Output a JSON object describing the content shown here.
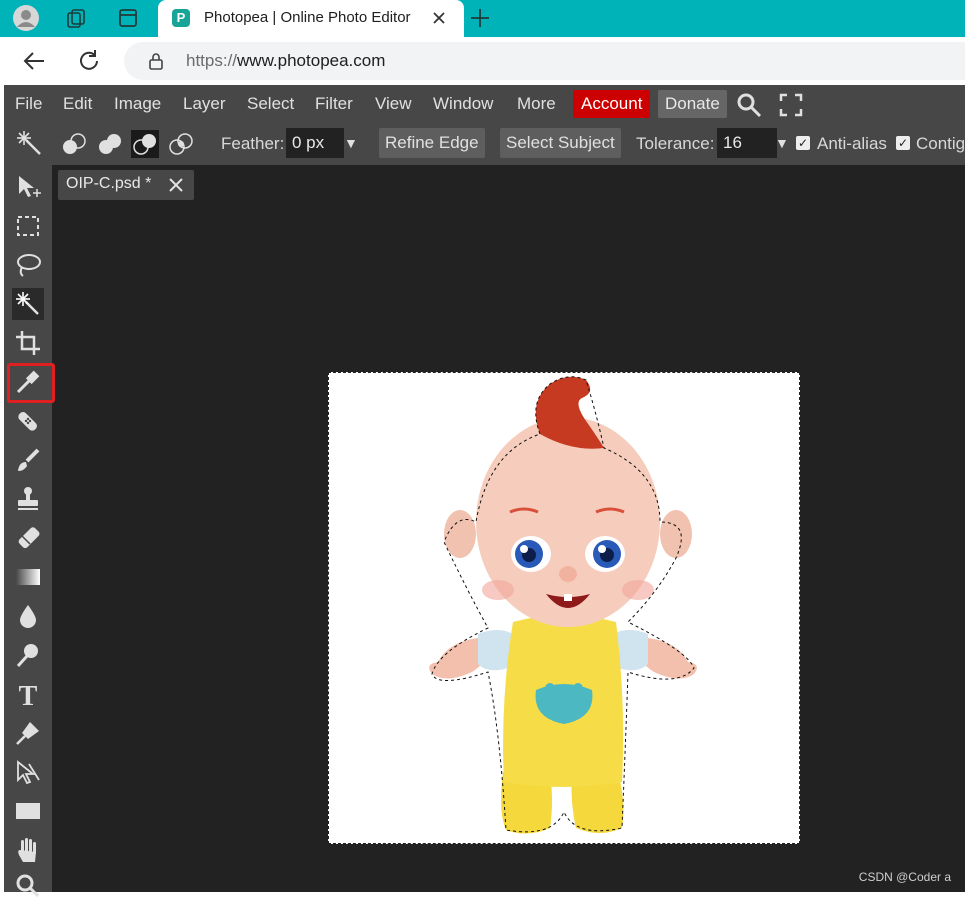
{
  "browser": {
    "tab_title": "Photopea | Online Photo Editor",
    "tab_favicon_letter": "P",
    "url_scheme": "https://",
    "url_host": "www.photopea.com",
    "icons": [
      "profile-icon",
      "collections-icon",
      "workspace-icon",
      "close-icon",
      "new-tab-icon",
      "back-icon",
      "refresh-icon",
      "lock-icon"
    ]
  },
  "menubar": {
    "items": [
      "File",
      "Edit",
      "Image",
      "Layer",
      "Select",
      "Filter",
      "View",
      "Window",
      "More"
    ],
    "account": "Account",
    "donate": "Donate"
  },
  "options": {
    "feather_label": "Feather:",
    "feather_value": "0 px",
    "refine_edge": "Refine Edge",
    "select_subject": "Select Subject",
    "tolerance_label": "Tolerance:",
    "tolerance_value": "16",
    "anti_alias_label": "Anti-alias",
    "contiguous_label": "Contig"
  },
  "document": {
    "tab_title": "OIP-C.psd *"
  },
  "tools": [
    "move-tool",
    "marquee-tool",
    "lasso-tool",
    "magic-wand-tool",
    "crop-tool",
    "eyedropper-tool",
    "healing-tool",
    "brush-tool",
    "clone-stamp-tool",
    "eraser-tool",
    "gradient-tool",
    "blur-tool",
    "dodge-tool",
    "type-tool",
    "pen-tool",
    "path-select-tool",
    "shape-tool",
    "hand-tool",
    "zoom-tool"
  ],
  "active_tool": "magic-wand-tool",
  "colors": {
    "tabbar": "#00b3b8",
    "panel": "#474747",
    "workspace": "#222222",
    "account": "#cc0000",
    "highlight": "#e02020"
  },
  "watermark": "CSDN @Coder a"
}
